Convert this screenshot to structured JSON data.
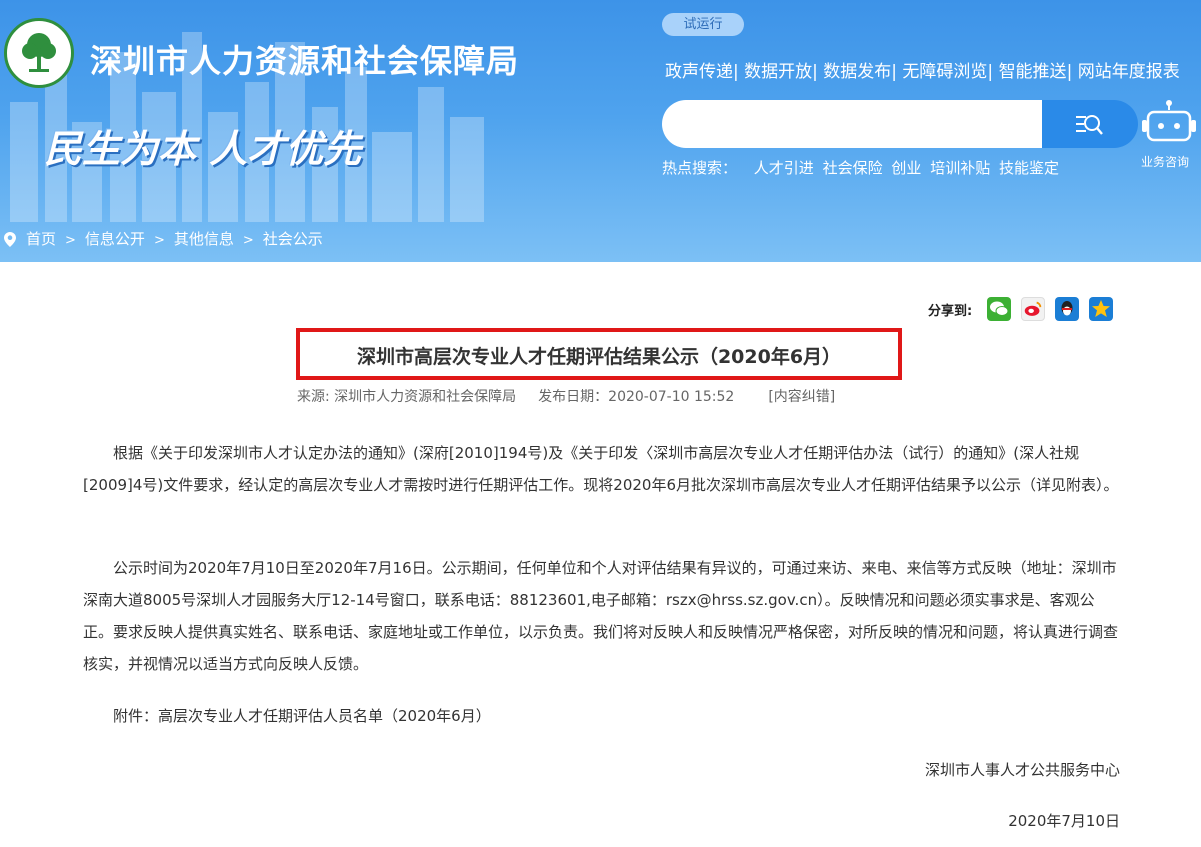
{
  "header": {
    "site_title": "深圳市人力资源和社会保障局",
    "slogan": "民生为本  人才优先",
    "trial_badge": "试运行",
    "top_links": [
      "政声传递",
      "数据开放",
      "数据发布",
      "无障碍浏览",
      "智能推送",
      "网站年度报表"
    ],
    "search": {
      "placeholder": "",
      "hot_label": "热点搜索：",
      "hot_items": [
        "人才引进",
        "社会保险",
        "创业",
        "培训补贴",
        "技能鉴定"
      ]
    },
    "robot_label": "业务咨询"
  },
  "breadcrumb": [
    "首页",
    "信息公开",
    "其他信息",
    "社会公示"
  ],
  "share": {
    "label": "分享到:",
    "icons": [
      "wechat-icon",
      "weibo-icon",
      "qq-icon",
      "qzone-icon"
    ]
  },
  "article": {
    "title": "深圳市高层次专业人才任期评估结果公示（2020年6月）",
    "source": "来源: 深圳市人力资源和社会保障局",
    "date": "发布日期：2020-07-10 15:52",
    "correction": "[内容纠错]",
    "paragraphs": [
      "根据《关于印发深圳市人才认定办法的通知》(深府[2010]194号)及《关于印发〈深圳市高层次专业人才任期评估办法（试行）的通知》(深人社规[2009]4号)文件要求，经认定的高层次专业人才需按时进行任期评估工作。现将2020年6月批次深圳市高层次专业人才任期评估结果予以公示（详见附表）。",
      "公示时间为2020年7月10日至2020年7月16日。公示期间，任何单位和个人对评估结果有异议的，可通过来访、来电、来信等方式反映（地址：深圳市深南大道8005号深圳人才园服务大厅12-14号窗口，联系电话：88123601,电子邮箱：rszx@hrss.sz.gov.cn）。反映情况和问题必须实事求是、客观公正。要求反映人提供真实姓名、联系电话、家庭地址或工作单位，以示负责。我们将对反映人和反映情况严格保密，对所反映的情况和问题，将认真进行调查核实，并视情况以适当方式向反映人反馈。",
      "附件：高层次专业人才任期评估人员名单（2020年6月）"
    ],
    "signature": "深圳市人事人才公共服务中心",
    "sign_date": "2020年7月10日"
  },
  "colors": {
    "banner": "#4fa3ee",
    "highlight_border": "#e01818",
    "search_button": "#2a8ae8"
  }
}
